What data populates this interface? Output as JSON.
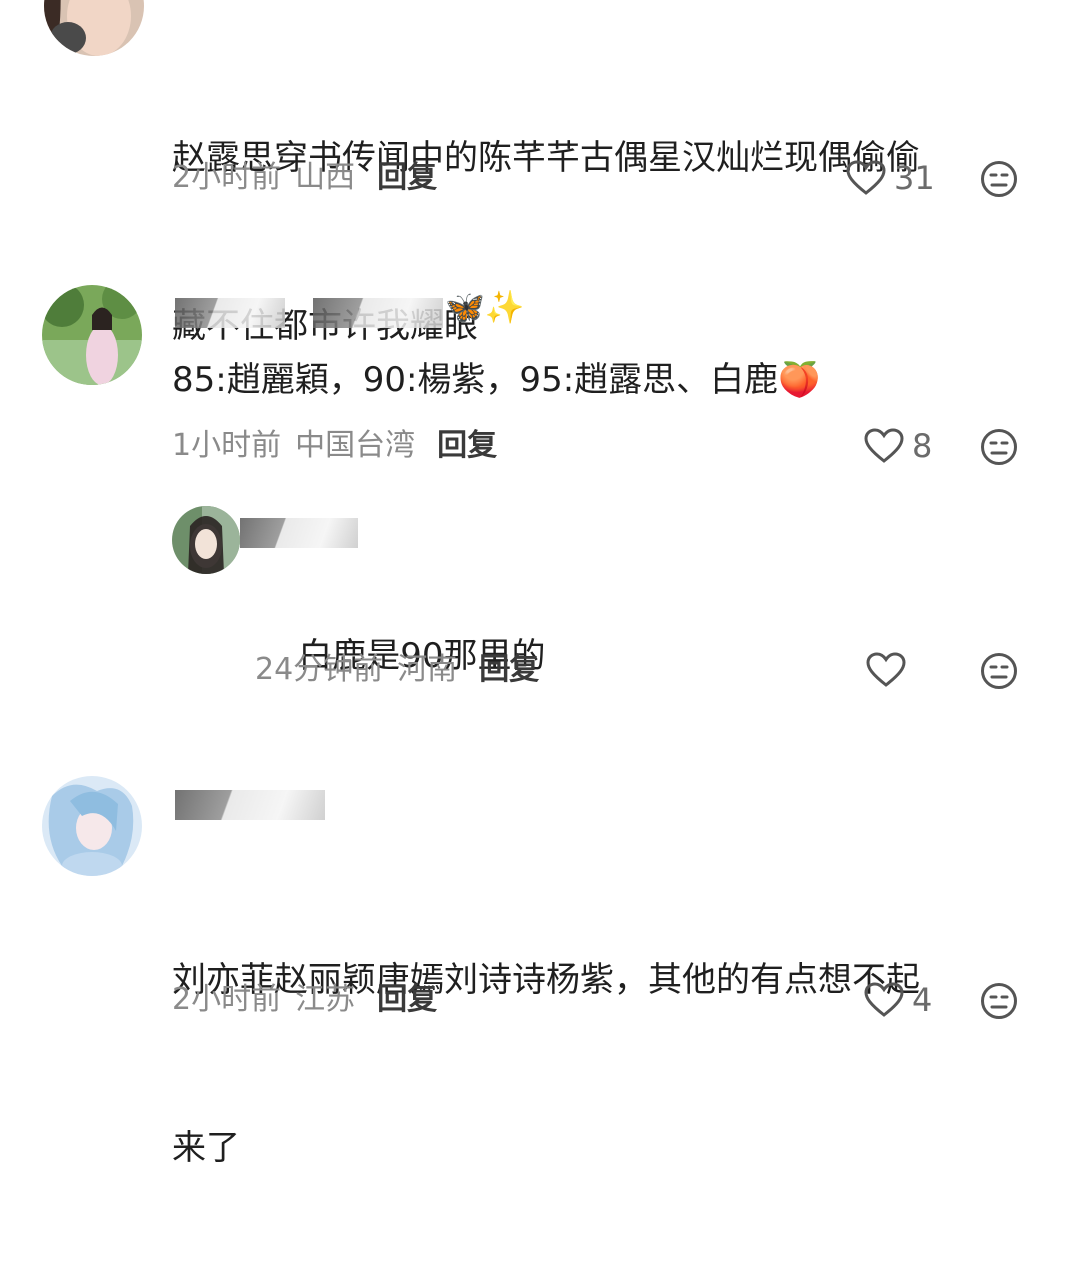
{
  "comments": [
    {
      "text_line1": "赵露思穿书传闻中的陈芊芊古偶星汉灿烂现偶偷偷",
      "text_line2": "藏不住都市许我耀眼",
      "time": "2小时前",
      "location": "山西",
      "reply": "回复",
      "likes": "31"
    },
    {
      "username_emoji": "🦋✨",
      "text": "85:趙麗穎，90:楊紫，95:趙露思、白鹿",
      "text_emoji": "🍑",
      "time": "1小时前",
      "location": "中国台湾",
      "reply": "回复",
      "likes": "8"
    },
    {
      "text": "白鹿是90那里的",
      "time": "24分钟前",
      "location": "河南",
      "reply": "回复",
      "likes": ""
    },
    {
      "text_line1": "刘亦菲赵丽颖唐嫣刘诗诗杨紫，其他的有点想不起",
      "text_line2": "来了",
      "time": "2小时前",
      "location": "江苏",
      "reply": "回复",
      "likes": "4"
    }
  ],
  "icons": {
    "like": "heart-outline-icon",
    "dislike": "neutral-face-icon"
  },
  "colors": {
    "text": "#1f1f1f",
    "meta": "#8a8a8a",
    "reply": "#3a3a3a"
  }
}
